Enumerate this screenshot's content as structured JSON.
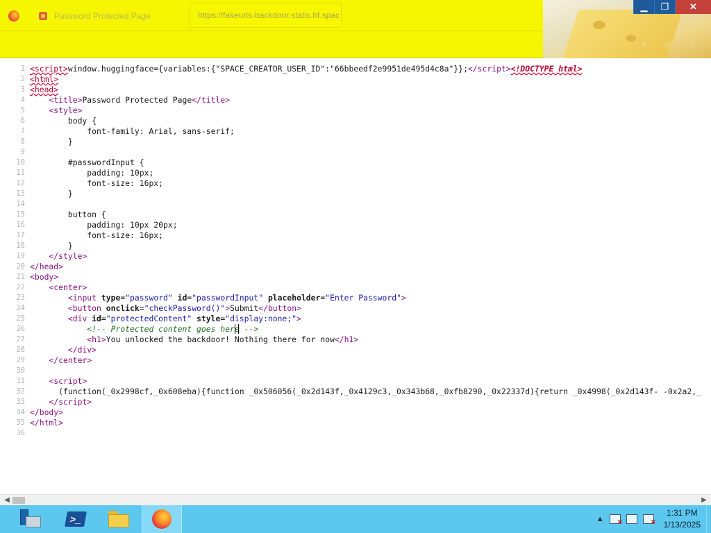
{
  "browser": {
    "tab_title": "Password Protected Page",
    "url": "https://fakeurls-backdoor.static.hf.space",
    "window_controls": {
      "minimize": "▁",
      "restore": "❐",
      "close": "✕"
    },
    "toolbar_icons": [
      "home-icon",
      "extensions-icon",
      "account-icon",
      "menu-icon"
    ],
    "accent_color": "#f6f600"
  },
  "source": {
    "lines": [
      "<script>window.huggingface={variables:{\"SPACE_CREATOR_USER_ID\":\"66bbeedf2e9951de495d4c8a\"}};</script><!DOCTYPE html>",
      "<html>",
      "<head>",
      "    <title>Password Protected Page</title>",
      "    <style>",
      "        body {",
      "            font-family: Arial, sans-serif;",
      "        }",
      "",
      "        #passwordInput {",
      "            padding: 10px;",
      "            font-size: 16px;",
      "        }",
      "",
      "        button {",
      "            padding: 10px 20px;",
      "            font-size: 16px;",
      "        }",
      "    </style>",
      "</head>",
      "<body>",
      "    <center>",
      "        <input type=\"password\" id=\"passwordInput\" placeholder=\"Enter Password\">",
      "        <button onclick=\"checkPassword()\">Submit</button>",
      "        <div id=\"protectedContent\" style=\"display:none;\">",
      "            <!-- Protected content goes here -->",
      "            <h1>You unlocked the backdoor! Nothing there for now</h1>",
      "        </div>",
      "    </center>",
      "",
      "    <script>",
      "      (function(_0x2998cf,_0x608eba){function _0x506056(_0x2d143f,_0x4129c3,_0x343b68,_0xfb8290,_0x22337d){return _0x4998(_0x2d143f- -0x2a2,_",
      "    </script>",
      "</body>",
      "</html>",
      ""
    ]
  },
  "taskbar": {
    "apps": [
      {
        "name": "Server Manager",
        "icon": "server-manager-icon"
      },
      {
        "name": "Windows PowerShell",
        "icon": "powershell-icon",
        "glyph": ">_"
      },
      {
        "name": "File Explorer",
        "icon": "folder-icon"
      },
      {
        "name": "Firefox",
        "icon": "firefox-icon"
      }
    ],
    "tray": {
      "show_hidden": "▲",
      "time": "1:31 PM",
      "date": "1/13/2025"
    }
  }
}
